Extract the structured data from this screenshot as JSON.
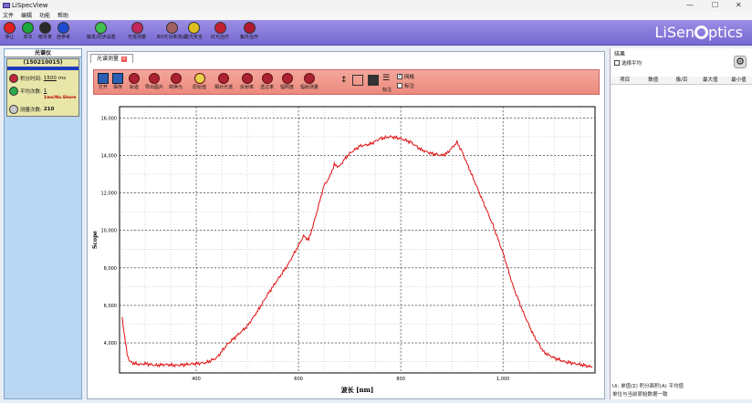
{
  "window": {
    "title": "LiSpecView",
    "minimize": "—",
    "maximize": "☐",
    "close": "✕"
  },
  "menu": [
    "文件",
    "编辑",
    "功能",
    "帮助"
  ],
  "toolbar": [
    {
      "label": "停止",
      "color": "#e02020"
    },
    {
      "label": "单次",
      "color": "#1aa83a"
    },
    {
      "label": "暗背景",
      "color": "#2a2a2a"
    },
    {
      "label": "自参考",
      "color": "#1d4bd0"
    },
    {
      "label": "触发/同步设置",
      "color": "#3fbf4f"
    },
    {
      "label": "光谱测量",
      "color": "#c0285a"
    },
    {
      "label": "BD光功率测试",
      "color": "#a06060"
    },
    {
      "label": "激光安全",
      "color": "#e0c020"
    },
    {
      "label": "红光治疗",
      "color": "#c62030"
    },
    {
      "label": "紫外治疗",
      "color": "#b01830"
    }
  ],
  "logo": {
    "left": "LiSen",
    "right": "ptics"
  },
  "device_panel": {
    "title": "光谱仪",
    "device_id": "(150210015)",
    "integration_label": "积分时间:",
    "integration_value": "1500",
    "integration_unit": "ms",
    "average_label": "平均次数:",
    "average_value": "1",
    "rate_text": "1ms/No.Share",
    "count_label": "测量次数:",
    "count_value": "210"
  },
  "tab": {
    "label": "光谱测量"
  },
  "ribbon": [
    {
      "label": "打开",
      "kind": "sq"
    },
    {
      "label": "保存",
      "kind": "sq"
    },
    {
      "label": "轨迹",
      "kind": "ic"
    },
    {
      "label": "导出图片",
      "kind": "ic"
    },
    {
      "label": "转换为",
      "kind": "ic"
    },
    {
      "label": "原始值",
      "kind": "ic",
      "active": true
    },
    {
      "label": "相对光谱",
      "kind": "ic"
    },
    {
      "label": "反射率",
      "kind": "ic"
    },
    {
      "label": "透过率",
      "kind": "ic"
    },
    {
      "label": "辐照度",
      "kind": "ic"
    },
    {
      "label": "辐射测量",
      "kind": "ic"
    },
    {
      "label": "标注",
      "kind": "ic"
    }
  ],
  "ribbon_checks": {
    "grid": "网格",
    "mark": "标注"
  },
  "results": {
    "title": "结果",
    "avg_check": "选择平均",
    "columns": [
      "项目",
      "数值",
      "像/百",
      "最大值",
      "最小值"
    ],
    "footer1": "Ui: 单值(Σ) 积分面积(A) 平均值",
    "footer2": "单位与当前原始数据一致"
  },
  "chart_data": {
    "type": "line",
    "xlabel": "波长 [nm]",
    "ylabel": "Scope",
    "xlim": [
      250,
      1180
    ],
    "ylim": [
      2400,
      16600
    ],
    "xticks": [
      400,
      600,
      800,
      1000
    ],
    "yticks": [
      4000,
      6000,
      8000,
      10000,
      12000,
      14000,
      16000
    ],
    "ytick_labels": [
      "4,000",
      "6,000",
      "8,000",
      "10,000",
      "12,000",
      "14,000",
      "16,000"
    ],
    "xtick_labels": [
      "400",
      "600",
      "800",
      "1,000"
    ],
    "grid": true,
    "series": [
      {
        "color": "#e01010",
        "x": [
          255,
          260,
          265,
          270,
          280,
          290,
          300,
          320,
          340,
          360,
          380,
          400,
          420,
          440,
          460,
          480,
          500,
          520,
          540,
          560,
          580,
          590,
          600,
          610,
          620,
          630,
          640,
          650,
          660,
          670,
          680,
          690,
          700,
          720,
          740,
          760,
          780,
          800,
          820,
          840,
          860,
          880,
          890,
          900,
          910,
          920,
          940,
          960,
          980,
          1000,
          1020,
          1040,
          1060,
          1080,
          1100,
          1120,
          1140,
          1160,
          1175
        ],
        "y": [
          5400,
          4300,
          3400,
          3000,
          2900,
          2850,
          2900,
          2800,
          2850,
          2800,
          2850,
          2900,
          2950,
          3200,
          3900,
          4400,
          4900,
          5700,
          6600,
          7400,
          8200,
          8700,
          9200,
          9700,
          9500,
          10400,
          11400,
          12400,
          12800,
          13500,
          13400,
          13800,
          14100,
          14500,
          14600,
          14900,
          15000,
          14900,
          14700,
          14300,
          14100,
          14000,
          14100,
          14400,
          14700,
          14200,
          12900,
          11600,
          10300,
          8800,
          7000,
          5600,
          4400,
          3500,
          3200,
          3000,
          2900,
          2800,
          2700
        ]
      }
    ]
  }
}
